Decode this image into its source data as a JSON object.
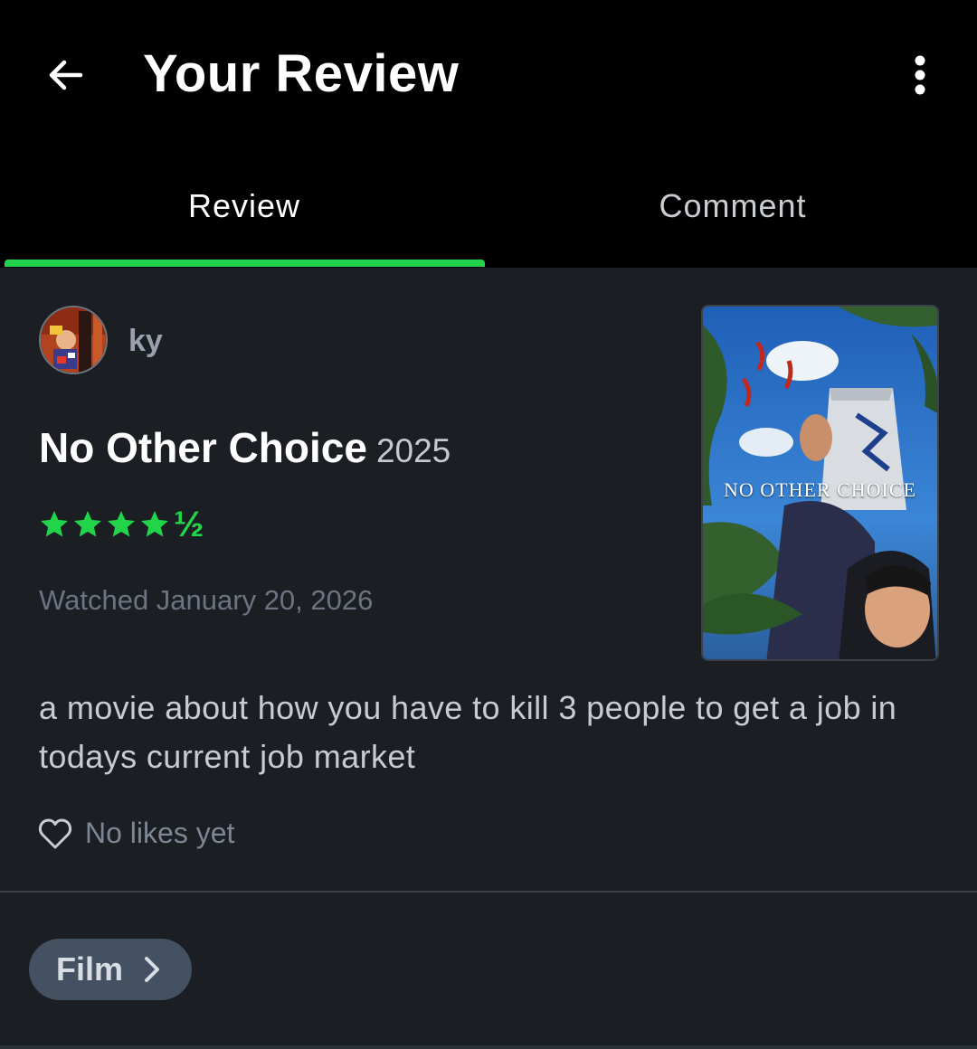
{
  "header": {
    "title": "Your Review",
    "back_icon": "arrow-left-icon",
    "menu_icon": "more-vertical-icon"
  },
  "tabs": [
    {
      "label": "Review",
      "active": true
    },
    {
      "label": "Comment",
      "active": false
    }
  ],
  "review": {
    "username": "ky",
    "film_title": "No Other Choice",
    "film_year": "2025",
    "rating_stars": 4.5,
    "rating_half_glyph": "½",
    "watched": "Watched January 20, 2026",
    "poster_title": "NO OTHER CHOICE",
    "text": "a movie about how you have to kill 3 people to get a job in todays current job market",
    "likes": "No likes yet"
  },
  "footer": {
    "chip_label": "Film"
  },
  "colors": {
    "accent": "#22d44a",
    "background": "#1b1e23",
    "header": "#000000",
    "chip": "#445162"
  }
}
